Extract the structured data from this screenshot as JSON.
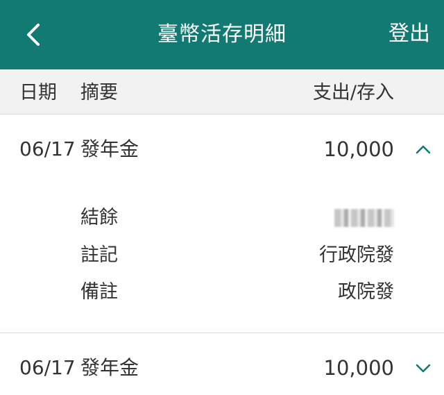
{
  "header": {
    "back_icon": "chevron-left-icon",
    "title": "臺幣活存明細",
    "logout_label": "登出",
    "bg_color": "#127a72"
  },
  "columns": {
    "date": "日期",
    "summary": "摘要",
    "amount": "支出/存入"
  },
  "transactions": [
    {
      "date": "06/17",
      "desc": "發年金",
      "amount": "10,000",
      "expanded": true,
      "toggle_icon": "chevron-up-icon",
      "details": [
        {
          "label": "結餘",
          "value": ""
        },
        {
          "label": "註記",
          "value": "行政院發"
        },
        {
          "label": "備註",
          "value": "政院發"
        }
      ]
    },
    {
      "date": "06/17",
      "desc": "發年金",
      "amount": "10,000",
      "expanded": false,
      "toggle_icon": "chevron-down-icon"
    }
  ],
  "accent_color": "#127a72"
}
